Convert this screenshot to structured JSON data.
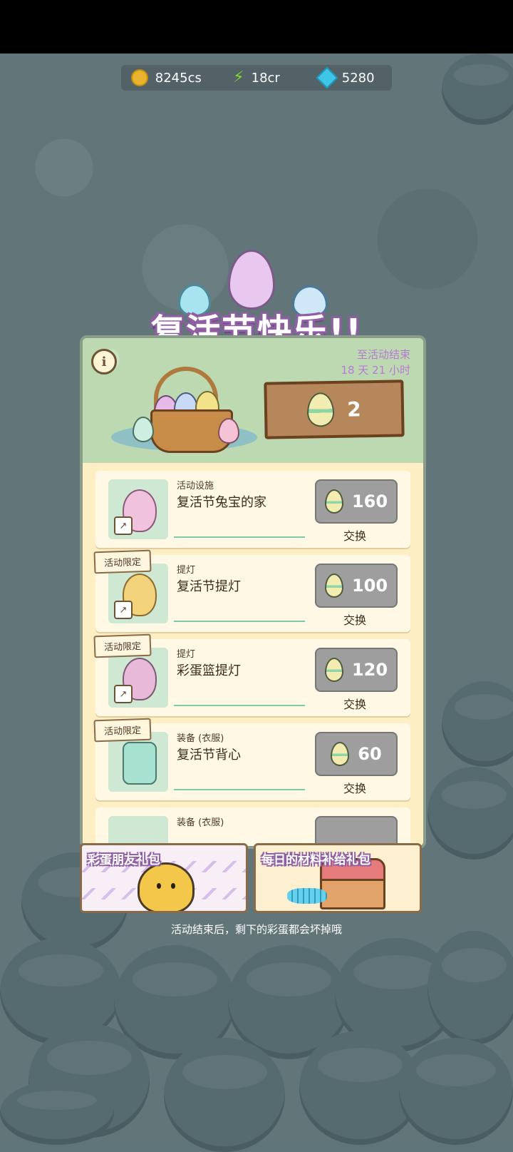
{
  "currency": {
    "coins": "8245cs",
    "energy": "18cr",
    "gems": "5280"
  },
  "event": {
    "title": "复活节快乐!!",
    "countdown_label": "至活动结束",
    "countdown_value": "18 天 21 小时",
    "egg_count": "2"
  },
  "items": [
    {
      "tag": "",
      "category": "活动设施",
      "name": "复活节兔宝的家",
      "cost": "160",
      "action": "交换"
    },
    {
      "tag": "活动限定",
      "category": "提灯",
      "name": "复活节提灯",
      "cost": "100",
      "action": "交换"
    },
    {
      "tag": "活动限定",
      "category": "提灯",
      "name": "彩蛋篮提灯",
      "cost": "120",
      "action": "交换"
    },
    {
      "tag": "活动限定",
      "category": "装备 (衣服)",
      "name": "复活节背心",
      "cost": "60",
      "action": "交换"
    },
    {
      "tag": "",
      "category": "装备 (衣服)",
      "name": "",
      "cost": "",
      "action": ""
    }
  ],
  "promos": {
    "left_title": "彩蛋朋友礼包",
    "right_title": "每日的材料补给礼包"
  },
  "footer_note": "活动结束后，剩下的彩蛋都会坏掉哦",
  "icons": {
    "coin": "coin-icon",
    "energy": "lightning-icon",
    "gem": "gem-icon",
    "info": "info-icon",
    "egg": "egg-icon",
    "link": "external-link-icon"
  }
}
